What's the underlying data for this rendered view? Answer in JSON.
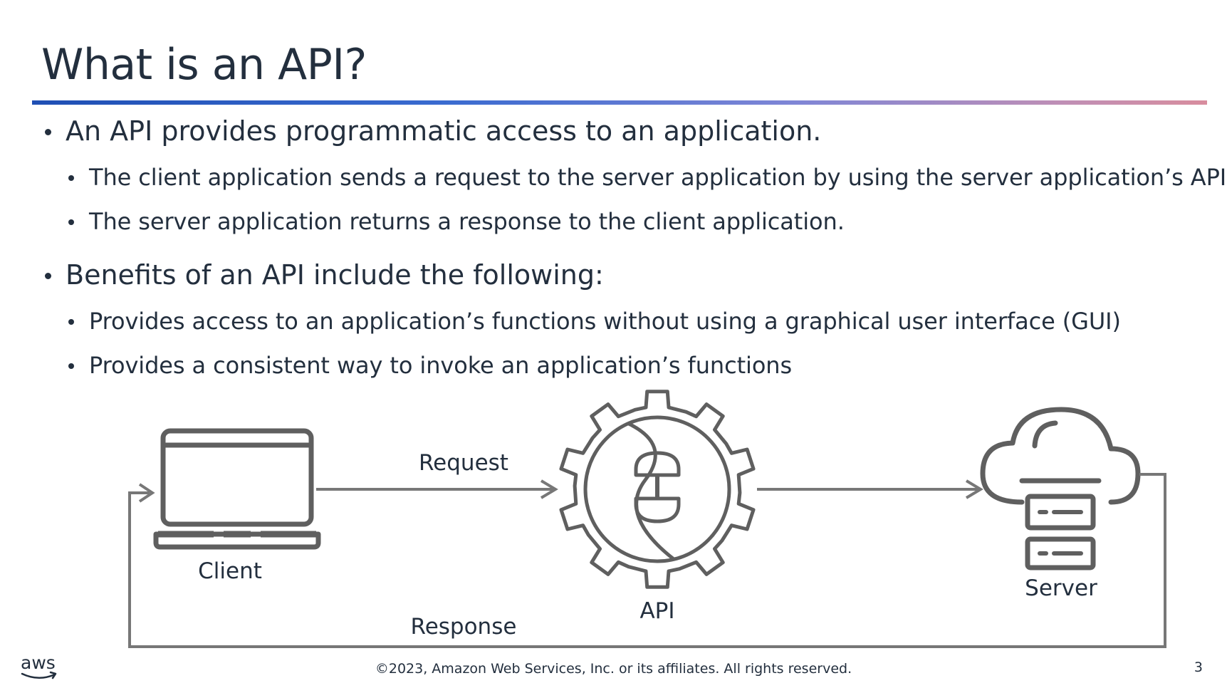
{
  "slide": {
    "title": "What is an API?",
    "bullets": [
      {
        "text": "An API provides programmatic access to an application."
      },
      {
        "text": "The client application sends a request to the server application by using the server application’s API."
      },
      {
        "text": "The server application returns a response to the client application."
      },
      {
        "text": "Benefits of an API include the following:"
      },
      {
        "text": "Provides access to an application’s functions without using a graphical user interface (GUI)"
      },
      {
        "text": "Provides a consistent way to invoke an application’s functions"
      }
    ]
  },
  "diagram": {
    "client_label": "Client",
    "api_label": "API",
    "server_label": "Server",
    "request_label": "Request",
    "response_label": "Response",
    "client_icon": "laptop-icon",
    "api_icon": "gear-plug-icon",
    "server_icon": "cloud-server-icon",
    "line_color": "#5f5f5f"
  },
  "footer": {
    "copyright": "©2023, Amazon Web Services, Inc. or its affiliates. All rights reserved.",
    "page_number": "3",
    "logo_text": "aws"
  },
  "colors": {
    "text": "#232f3e",
    "rule_start": "#1f4fb4",
    "rule_end": "#d88d9e"
  }
}
